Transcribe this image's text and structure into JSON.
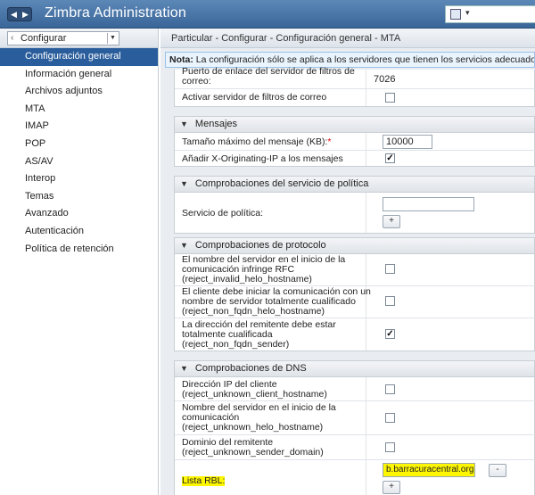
{
  "app": {
    "title": "Zimbra Administration"
  },
  "topbar": {
    "nav_back": "◀",
    "nav_fwd": "▶",
    "search_dropdown": "▾"
  },
  "leftnav": {
    "combo_label": "Configurar",
    "items": [
      {
        "label": "Configuración general",
        "selected": true
      },
      {
        "label": "Información general"
      },
      {
        "label": "Archivos adjuntos"
      },
      {
        "label": "MTA"
      },
      {
        "label": "IMAP"
      },
      {
        "label": "POP"
      },
      {
        "label": "AS/AV"
      },
      {
        "label": "Interop"
      },
      {
        "label": "Temas"
      },
      {
        "label": "Avanzado"
      },
      {
        "label": "Autenticación"
      },
      {
        "label": "Política de retención"
      }
    ]
  },
  "main": {
    "breadcrumb": "Particular - Configurar - Configuración general - MTA",
    "note_bold": "Nota:",
    "note_text": "La configuración sólo se aplica a los servidores que tienen los servicios adecuados inst"
  },
  "top_section": {
    "port_label": "Puerto de enlace del servidor de filtros de correo:",
    "port_value": "7026",
    "activate_label": "Activar servidor de filtros de correo",
    "activate_checked": false
  },
  "mensajes": {
    "title": "Mensajes",
    "max_size_label": "Tamaño máximo del mensaje (KB):",
    "required_mark": "*",
    "max_size_value": "10000",
    "xorig_label": "Añadir X-Originating-IP a los mensajes",
    "xorig_checked": true
  },
  "politica": {
    "title": "Comprobaciones del servicio de política",
    "service_label": "Servicio de política:",
    "service_value": "",
    "add_button": "+"
  },
  "protocolo": {
    "title": "Comprobaciones de protocolo",
    "rows": [
      {
        "l1": "El nombre del servidor en el inicio de la",
        "l2": "comunicación infringe RFC",
        "l3": "(reject_invalid_helo_hostname)",
        "checked": false
      },
      {
        "l1": "El cliente debe iniciar la comunicación con un",
        "l2": "nombre de servidor totalmente cualificado",
        "l3": "(reject_non_fqdn_helo_hostname)",
        "checked": false
      },
      {
        "l1": "La dirección del remitente debe estar",
        "l2": "totalmente cualificada",
        "l3": "(reject_non_fqdn_sender)",
        "checked": true
      }
    ]
  },
  "dns": {
    "title": "Comprobaciones de DNS",
    "rows": [
      {
        "l1": "Dirección IP del cliente",
        "l2": "(reject_unknown_client_hostname)",
        "checked": false
      },
      {
        "l1": "Nombre del servidor en el inicio de la",
        "l2": "comunicación",
        "l3": "(reject_unknown_helo_hostname)",
        "checked": false
      },
      {
        "l1": "Dominio del remitente",
        "l2": "(reject_unknown_sender_domain)",
        "checked": false
      }
    ],
    "rbl_label": "Lista RBL:",
    "rbl_value": "b.barracuracentral.org",
    "remove_button": "-",
    "add_button": "+"
  },
  "colors": {
    "topbar": "#3a6598",
    "selected_nav": "#2a5d9b",
    "highlight": "#fff700"
  }
}
